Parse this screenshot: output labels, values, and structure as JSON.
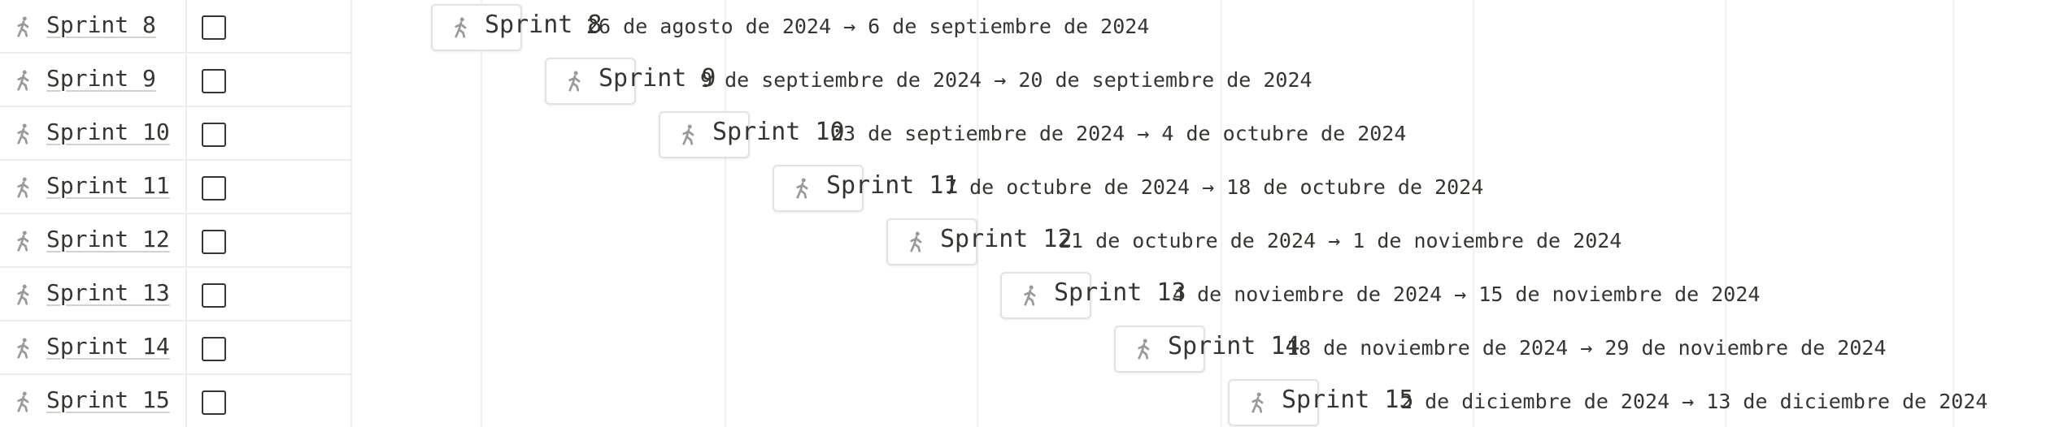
{
  "colors": {
    "text": "#37352f",
    "icon": "#9b9a97",
    "border": "#ededeb",
    "bar_border": "#e3e2df"
  },
  "row_icon_name": "walking-person-icon",
  "sprints": [
    {
      "name": "Sprint 8",
      "checked": false,
      "dates": "26 de agosto de 2024 → 6 de septiembre de 2024"
    },
    {
      "name": "Sprint 9",
      "checked": false,
      "dates": "9 de septiembre de 2024 → 20 de septiembre de 2024"
    },
    {
      "name": "Sprint 10",
      "checked": false,
      "dates": "23 de septiembre de 2024 → 4 de octubre de 2024"
    },
    {
      "name": "Sprint 11",
      "checked": false,
      "dates": "7 de octubre de 2024 → 18 de octubre de 2024"
    },
    {
      "name": "Sprint 12",
      "checked": false,
      "dates": "21 de octubre de 2024 → 1 de noviembre de 2024"
    },
    {
      "name": "Sprint 13",
      "checked": false,
      "dates": "4 de noviembre de 2024 → 15 de noviembre de 2024"
    },
    {
      "name": "Sprint 14",
      "checked": false,
      "dates": "18 de noviembre de 2024 → 29 de noviembre de 2024"
    },
    {
      "name": "Sprint 15",
      "checked": false,
      "dates": "2 de diciembre de 2024 → 13 de diciembre de 2024"
    }
  ]
}
